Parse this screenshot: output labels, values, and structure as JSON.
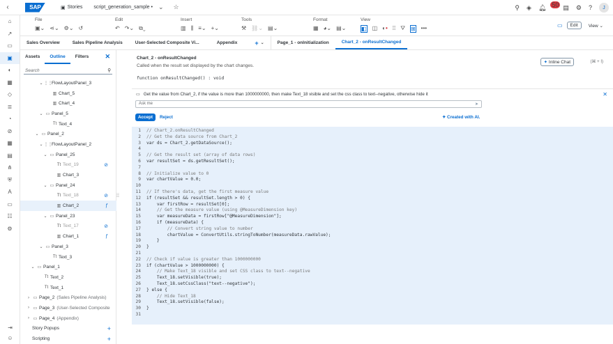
{
  "shell": {
    "logo": "SAP",
    "stories": "Stories",
    "file_name": "script_generation_sample",
    "unsaved": "•",
    "notification_count": "50",
    "avatar": "J"
  },
  "toolbar": {
    "groups": [
      {
        "label": "File"
      },
      {
        "label": "Edit"
      },
      {
        "label": "Insert"
      },
      {
        "label": "Tools"
      },
      {
        "label": "Format"
      },
      {
        "label": "View"
      }
    ],
    "edit_btn": "Edit",
    "view_btn": "View"
  },
  "tabs": [
    {
      "label": "Sales Overview"
    },
    {
      "label": "Sales Pipeline Analysis"
    },
    {
      "label": "User-Selected Composite Vi..."
    },
    {
      "label": "Appendix"
    },
    {
      "label": "+"
    },
    {
      "label": "Page_1 - onInitialization"
    },
    {
      "label": "Chart_2 - onResultChanged"
    }
  ],
  "panel": {
    "tabs": [
      {
        "label": "Assets"
      },
      {
        "label": "Outline"
      },
      {
        "label": "Filters"
      }
    ],
    "search_placeholder": "Search",
    "tree": [
      {
        "label": "FlowLayoutPanel_3",
        "icon": "⋮⋮",
        "chev": "⌄",
        "indent": 26
      },
      {
        "label": "Chart_5",
        "icon": "▥",
        "chev": "",
        "indent": 36
      },
      {
        "label": "Chart_4",
        "icon": "▥",
        "chev": "",
        "indent": 36
      },
      {
        "label": "Panel_5",
        "icon": "▭",
        "chev": "⌄",
        "indent": 26
      },
      {
        "label": "Text_4",
        "icon": "Tt",
        "chev": "",
        "indent": 36
      },
      {
        "label": "Panel_2",
        "icon": "▭",
        "chev": "⌄",
        "indent": 20
      },
      {
        "label": "FlowLayoutPanel_2",
        "icon": "⋮⋮",
        "chev": "⌄",
        "indent": 26
      },
      {
        "label": "Panel_25",
        "icon": "▭",
        "chev": "⌄",
        "indent": 32
      },
      {
        "label": "Text_19",
        "icon": "Tt",
        "chev": "",
        "indent": 42,
        "hidden": true
      },
      {
        "label": "Chart_3",
        "icon": "▥",
        "chev": "",
        "indent": 42
      },
      {
        "label": "Panel_24",
        "icon": "▭",
        "chev": "⌄",
        "indent": 32
      },
      {
        "label": "Text_18",
        "icon": "Tt",
        "chev": "",
        "indent": 42,
        "hidden": true
      },
      {
        "label": "Chart_2",
        "icon": "▥",
        "chev": "",
        "indent": 42,
        "selected": true,
        "script": true
      },
      {
        "label": "Panel_23",
        "icon": "▭",
        "chev": "⌄",
        "indent": 32
      },
      {
        "label": "Text_17",
        "icon": "Tt",
        "chev": "",
        "indent": 42,
        "hidden": true
      },
      {
        "label": "Chart_1",
        "icon": "▥",
        "chev": "",
        "indent": 42,
        "script": true
      },
      {
        "label": "Panel_3",
        "icon": "▭",
        "chev": "⌄",
        "indent": 26
      },
      {
        "label": "Text_3",
        "icon": "Tt",
        "chev": "",
        "indent": 36
      },
      {
        "label": "Panel_1",
        "icon": "▭",
        "chev": "⌄",
        "indent": 14
      },
      {
        "label": "Text_2",
        "icon": "Tt",
        "chev": "",
        "indent": 24
      },
      {
        "label": "Text_1",
        "icon": "Tt",
        "chev": "",
        "indent": 24
      },
      {
        "label": "Page_2",
        "sub": "(Sales Pipeline Analysis)",
        "icon": "▭",
        "chev": "›",
        "indent": 8
      },
      {
        "label": "Page_3",
        "sub": "(User-Selected Composite",
        "icon": "▭",
        "chev": "›",
        "indent": 8
      },
      {
        "label": "Page_4",
        "sub": "(Appendix)",
        "icon": "▭",
        "chev": "›",
        "indent": 8
      }
    ],
    "story_popups": "Story Popups",
    "scripting": "Scripting"
  },
  "editor": {
    "title": "Chart_2 - onResultChanged",
    "description": "Called when the result set displayed by the chart changes.",
    "inline_chat": "Inline Chat",
    "shortcut": "(⌘ + I)",
    "signature": "function onResultChanged() : void",
    "prompt": "Get the value from Chart_2, if the value is more than 1000000000, then make Text_18 visible and set the css class to text--negative, otherwise hide it",
    "ask_placeholder": "Ask me",
    "accept": "Accept",
    "reject": "Reject",
    "created_with_ai": "Created with AI.",
    "code": [
      "// Chart_2.onResultChanged",
      "// Get the data source from Chart_2",
      "var ds = Chart_2.getDataSource();",
      "",
      "// Get the result set (array of data rows)",
      "var resultSet = ds.getResultSet();",
      "",
      "// Initialize value to 0",
      "var chartValue = 0.0;",
      "",
      "// If there's data, get the first measure value",
      "if (resultSet && resultSet.length > 0) {",
      "    var firstRow = resultSet[0];",
      "    // Get the measure value (using @MeasureDimension key)",
      "    var measureData = firstRow[\"@MeasureDimension\"];",
      "    if (measureData) {",
      "        // Convert string value to number",
      "        chartValue = ConvertUtils.stringToNumber(measureData.rawValue);",
      "    }",
      "}",
      "",
      "// Check if value is greater than 1000000000",
      "if (chartValue > 1000000000) {",
      "    // Make Text_18 visible and set CSS class to text--negative",
      "    Text_18.setVisible(true);",
      "    Text_18.setCssClass(\"text--negative\");",
      "} else {",
      "    // Hide Text_18",
      "    Text_18.setVisible(false);",
      "}",
      ""
    ]
  }
}
